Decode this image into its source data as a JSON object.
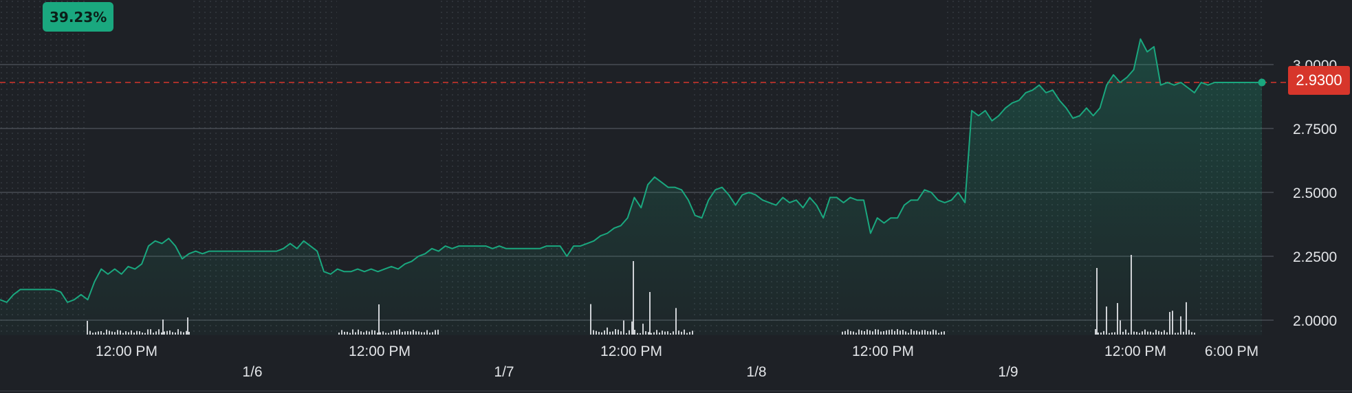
{
  "badge": {
    "change_pct": "39.23%"
  },
  "current_price": {
    "label": "2.9300",
    "value": 2.93
  },
  "colors": {
    "line": "#1aa87f",
    "accent_red": "#d7362b",
    "background": "#1e2126",
    "grid": "#50555c",
    "volume": "#d0d3d7",
    "text": "#e3e5e8"
  },
  "chart_data": {
    "type": "area",
    "y_axis": {
      "ticks": [
        "2.0000",
        "2.2500",
        "2.5000",
        "2.7500",
        "3.0000"
      ],
      "ylim": [
        1.95,
        3.15
      ]
    },
    "x_axis": {
      "time_labels": [
        "12:00 PM",
        "12:00 PM",
        "12:00 PM",
        "12:00 PM",
        "12:00 PM",
        "6:00 PM"
      ],
      "date_labels": [
        "1/6",
        "1/7",
        "1/8",
        "1/9"
      ]
    },
    "grid": true,
    "series": [
      {
        "values": [
          2.08,
          2.07,
          2.1,
          2.12,
          2.12,
          2.12,
          2.12,
          2.12,
          2.12,
          2.11,
          2.07,
          2.08,
          2.1,
          2.08,
          2.15,
          2.2,
          2.18,
          2.2,
          2.18,
          2.21,
          2.2,
          2.22,
          2.29,
          2.31,
          2.3,
          2.32,
          2.29,
          2.24,
          2.26,
          2.27,
          2.26,
          2.27,
          2.27,
          2.27,
          2.27,
          2.27,
          2.27,
          2.27,
          2.27,
          2.27,
          2.27,
          2.27,
          2.28,
          2.3,
          2.28,
          2.31,
          2.29,
          2.27,
          2.19,
          2.18,
          2.2,
          2.19,
          2.19,
          2.2,
          2.19,
          2.2,
          2.19,
          2.2,
          2.21,
          2.2,
          2.22,
          2.23,
          2.25,
          2.26,
          2.28,
          2.27,
          2.29,
          2.28,
          2.29,
          2.29,
          2.29,
          2.29,
          2.29,
          2.28,
          2.29,
          2.28,
          2.28,
          2.28,
          2.28,
          2.28,
          2.28,
          2.29,
          2.29,
          2.29,
          2.25,
          2.29,
          2.29,
          2.3,
          2.31,
          2.33,
          2.34,
          2.36,
          2.37,
          2.4,
          2.48,
          2.44,
          2.53,
          2.56,
          2.54,
          2.52,
          2.52,
          2.51,
          2.47,
          2.41,
          2.4,
          2.47,
          2.51,
          2.52,
          2.49,
          2.45,
          2.49,
          2.5,
          2.49,
          2.47,
          2.46,
          2.45,
          2.48,
          2.46,
          2.47,
          2.44,
          2.48,
          2.45,
          2.4,
          2.48,
          2.48,
          2.46,
          2.48,
          2.47,
          2.47,
          2.34,
          2.4,
          2.38,
          2.4,
          2.4,
          2.45,
          2.47,
          2.47,
          2.51,
          2.5,
          2.47,
          2.46,
          2.47,
          2.5,
          2.46,
          2.82,
          2.8,
          2.82,
          2.78,
          2.8,
          2.83,
          2.85,
          2.86,
          2.89,
          2.9,
          2.92,
          2.89,
          2.9,
          2.86,
          2.83,
          2.79,
          2.8,
          2.83,
          2.8,
          2.83,
          2.92,
          2.96,
          2.93,
          2.95,
          2.98,
          3.1,
          3.05,
          3.07,
          2.92,
          2.93,
          2.92,
          2.93,
          2.91,
          2.89,
          2.93,
          2.92,
          2.93,
          2.93,
          2.93,
          2.93,
          2.93,
          2.93,
          2.93,
          2.93
        ]
      }
    ]
  }
}
